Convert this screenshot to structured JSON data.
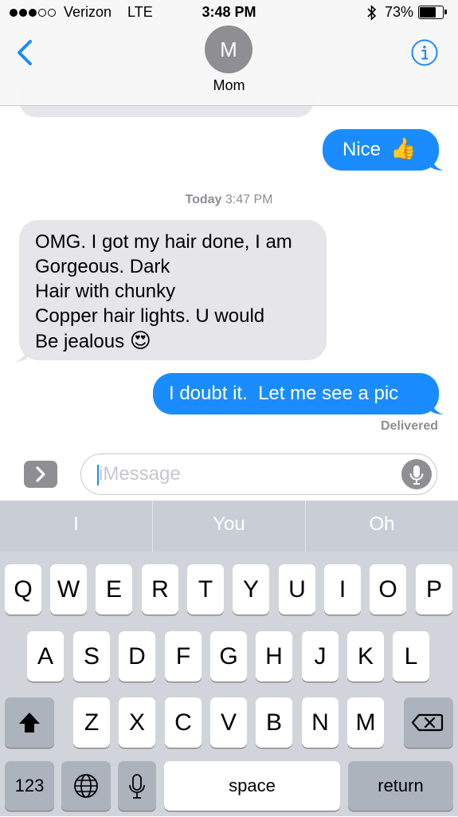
{
  "status_bar": {
    "carrier": "Verizon",
    "network": "LTE",
    "time": "3:48 PM",
    "battery": "73%",
    "battery_level": 0.73,
    "signal_bars_filled": 3,
    "signal_bars_total": 5
  },
  "header": {
    "avatar_initial": "M",
    "contact_name": "Mom",
    "back_icon": "chevron-left-icon",
    "info_icon": "info-circle-icon"
  },
  "messages": [
    {
      "direction": "outgoing",
      "text": "Nice",
      "emoji": "👍"
    },
    {
      "direction": "incoming",
      "lines": [
        "OMG. I got my hair done, I am",
        "Gorgeous. Dark",
        "Hair with chunky",
        "Copper hair lights. U would",
        "Be jealous"
      ],
      "emoji": "😍"
    },
    {
      "direction": "outgoing",
      "text": "I doubt it.  Let me see a pic"
    }
  ],
  "timestamp": {
    "day": "Today",
    "time": "3:47 PM"
  },
  "delivered": "Delivered",
  "composer": {
    "placeholder": "iMessage"
  },
  "suggestions": [
    "I",
    "You",
    "Oh"
  ],
  "keyboard": {
    "row1": [
      "Q",
      "W",
      "E",
      "R",
      "T",
      "Y",
      "U",
      "I",
      "O",
      "P"
    ],
    "row2": [
      "A",
      "S",
      "D",
      "F",
      "G",
      "H",
      "J",
      "K",
      "L"
    ],
    "row3": [
      "Z",
      "X",
      "C",
      "V",
      "B",
      "N",
      "M"
    ],
    "numbers_key": "123",
    "space_key": "space",
    "return_key": "return"
  },
  "colors": {
    "outgoing_bubble": "#1a8cff",
    "incoming_bubble": "#e5e5ea",
    "accent": "#1a8cff"
  }
}
